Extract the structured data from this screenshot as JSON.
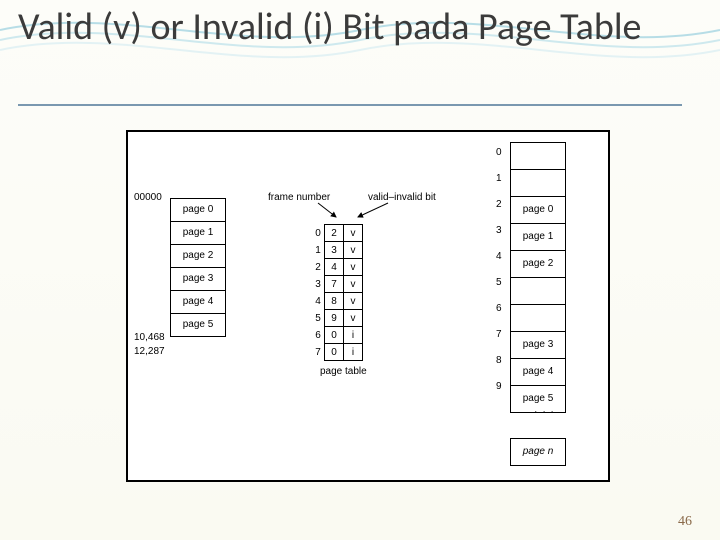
{
  "title": "Valid (v) or Invalid (i) Bit pada Page Table",
  "page_number": "46",
  "labels": {
    "addr_top": "00000",
    "addr_mid": "10,468",
    "addr_bot": "12,287",
    "frame_number": "frame number",
    "valid_bit": "valid–invalid bit",
    "page_table": "page table"
  },
  "logical_pages": [
    "page 0",
    "page 1",
    "page 2",
    "page 3",
    "page 4",
    "page 5"
  ],
  "page_table_rows": [
    {
      "i": "0",
      "f": "2",
      "b": "v"
    },
    {
      "i": "1",
      "f": "3",
      "b": "v"
    },
    {
      "i": "2",
      "f": "4",
      "b": "v"
    },
    {
      "i": "3",
      "f": "7",
      "b": "v"
    },
    {
      "i": "4",
      "f": "8",
      "b": "v"
    },
    {
      "i": "5",
      "f": "9",
      "b": "v"
    },
    {
      "i": "6",
      "f": "0",
      "b": "i"
    },
    {
      "i": "7",
      "f": "0",
      "b": "i"
    }
  ],
  "frames": [
    {
      "n": "0",
      "c": ""
    },
    {
      "n": "1",
      "c": ""
    },
    {
      "n": "2",
      "c": "page 0"
    },
    {
      "n": "3",
      "c": "page 1"
    },
    {
      "n": "4",
      "c": "page 2"
    },
    {
      "n": "5",
      "c": ""
    },
    {
      "n": "6",
      "c": ""
    },
    {
      "n": "7",
      "c": "page 3"
    },
    {
      "n": "8",
      "c": "page 4"
    },
    {
      "n": "9",
      "c": "page 5"
    }
  ],
  "page_n": "page n",
  "chart_data": {
    "type": "table",
    "title": "Valid/Invalid bit in a page table",
    "logical_address_space": {
      "pages": [
        "page 0",
        "page 1",
        "page 2",
        "page 3",
        "page 4",
        "page 5"
      ],
      "low_addr": "00000",
      "high_addrs": [
        "10,468",
        "12,287"
      ]
    },
    "page_table": {
      "columns": [
        "page",
        "frame",
        "valid"
      ],
      "rows": [
        [
          0,
          2,
          "v"
        ],
        [
          1,
          3,
          "v"
        ],
        [
          2,
          4,
          "v"
        ],
        [
          3,
          7,
          "v"
        ],
        [
          4,
          8,
          "v"
        ],
        [
          5,
          9,
          "v"
        ],
        [
          6,
          0,
          "i"
        ],
        [
          7,
          0,
          "i"
        ]
      ]
    },
    "physical_memory": {
      "frames": 10,
      "mapping": {
        "2": "page 0",
        "3": "page 1",
        "4": "page 2",
        "7": "page 3",
        "8": "page 4",
        "9": "page 5"
      },
      "last_frame": "page n"
    }
  }
}
